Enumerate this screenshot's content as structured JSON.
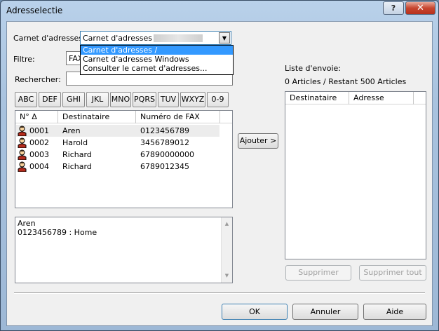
{
  "window": {
    "title": "Adresselectie",
    "help_label": "?",
    "close_label": "✕"
  },
  "carnet": {
    "label": "Carnet d'adresses:",
    "selected": "Carnet d'adresses /",
    "options": [
      "Carnet d'adresses /",
      "Carnet d'adresses Windows",
      "Consulter le carnet d'adresses..."
    ]
  },
  "filter": {
    "label": "Filtre:",
    "value": "FAX"
  },
  "search": {
    "label": "Rechercher:",
    "value": ""
  },
  "alpha_buttons": [
    "ABC",
    "DEF",
    "GHI",
    "JKL",
    "MNO",
    "PQRS",
    "TUV",
    "WXYZ",
    "0-9"
  ],
  "address_list": {
    "columns": [
      "N° Δ",
      "Destinataire",
      "Numéro de FAX"
    ],
    "rows": [
      {
        "num": "0001",
        "name": "Aren",
        "fax": "0123456789"
      },
      {
        "num": "0002",
        "name": "Harold",
        "fax": "3456789012"
      },
      {
        "num": "0003",
        "name": "Richard",
        "fax": "67890000000"
      },
      {
        "num": "0004",
        "name": "Richard",
        "fax": "6789012345"
      }
    ]
  },
  "details": {
    "line1": "Aren",
    "line2": "0123456789 : Home"
  },
  "add_button": "Ajouter >",
  "send_list": {
    "label": "Liste d'envoie:",
    "status": "0 Articles / Restant 500 Articles",
    "columns": [
      "Destinataire",
      "Adresse"
    ]
  },
  "delete_button": "Supprimer",
  "delete_all_button": "Supprimer tout",
  "footer": {
    "ok": "OK",
    "cancel": "Annuler",
    "help": "Aide"
  }
}
